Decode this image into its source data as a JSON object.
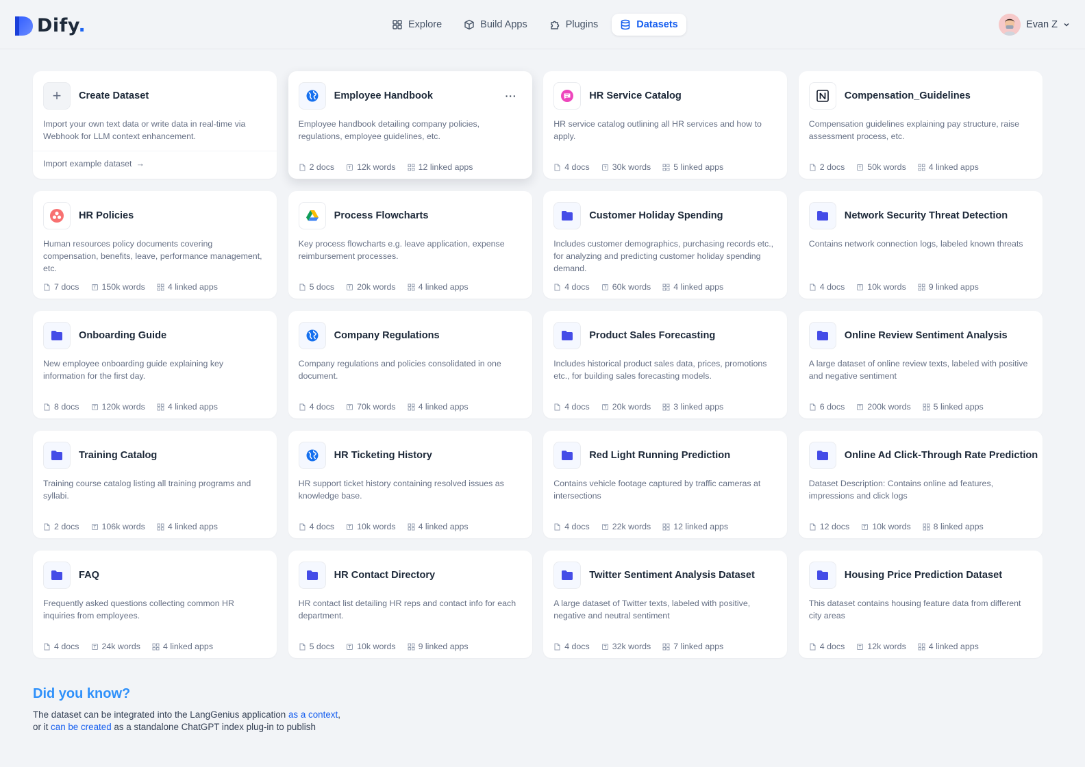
{
  "app": {
    "name": "Dify",
    "name_suffix": "."
  },
  "nav": {
    "items": [
      {
        "label": "Explore",
        "icon": "grid-icon"
      },
      {
        "label": "Build Apps",
        "icon": "cube-icon"
      },
      {
        "label": "Plugins",
        "icon": "puzzle-icon"
      },
      {
        "label": "Datasets",
        "icon": "database-icon",
        "active": true
      }
    ]
  },
  "user": {
    "name": "Evan Z"
  },
  "create": {
    "title": "Create Dataset",
    "description": "Import your own text data or write data in real-time via Webhook for LLM context enhancement.",
    "link": "Import example dataset",
    "arrow": "→"
  },
  "datasets": [
    {
      "title": "Employee Handbook",
      "icon": "globe-icon",
      "description": "Employee handbook detailing company policies, regulations, employee guidelines, etc.",
      "docs": "2 docs",
      "words": "12k words",
      "apps": "12 linked apps"
    },
    {
      "title": "HR Service Catalog",
      "icon": "chat-bubble-icon",
      "description": "HR service catalog outlining all HR services and how to apply.",
      "docs": "4 docs",
      "words": "30k words",
      "apps": "5 linked apps"
    },
    {
      "title": "Compensation_Guidelines",
      "icon": "notion-icon",
      "description": "Compensation guidelines explaining pay structure, raise assessment process, etc.",
      "docs": "2 docs",
      "words": "50k words",
      "apps": "4 linked apps"
    },
    {
      "title": "HR Policies",
      "icon": "asana-icon",
      "description": "Human resources policy documents covering compensation, benefits, leave, performance management, etc.",
      "docs": "7 docs",
      "words": "150k words",
      "apps": "4 linked apps"
    },
    {
      "title": "Process Flowcharts",
      "icon": "google-drive-icon",
      "description": "Key process flowcharts e.g. leave application, expense reimbursement processes.",
      "docs": "5 docs",
      "words": "20k words",
      "apps": "4 linked apps"
    },
    {
      "title": "Customer Holiday Spending",
      "icon": "folder-icon",
      "description": "Includes customer demographics, purchasing records etc., for analyzing and predicting customer holiday spending demand.",
      "docs": "4 docs",
      "words": "60k words",
      "apps": "4 linked apps"
    },
    {
      "title": "Network Security Threat Detection",
      "icon": "folder-icon",
      "description": "Contains network connection logs, labeled known threats",
      "docs": "4 docs",
      "words": "10k words",
      "apps": "9 linked apps"
    },
    {
      "title": "Onboarding Guide",
      "icon": "folder-icon",
      "description": "New employee onboarding guide explaining key information for the first day.",
      "docs": "8 docs",
      "words": "120k words",
      "apps": "4 linked apps"
    },
    {
      "title": "Company Regulations",
      "icon": "globe-icon",
      "description": "Company regulations and policies consolidated in one document.",
      "docs": "4 docs",
      "words": "70k words",
      "apps": "4 linked apps"
    },
    {
      "title": "Product Sales Forecasting",
      "icon": "folder-icon",
      "description": " Includes historical product sales data, prices, promotions etc., for building sales forecasting models.",
      "docs": "4 docs",
      "words": "20k words",
      "apps": "3 linked apps"
    },
    {
      "title": "Online Review Sentiment Analysis",
      "icon": "folder-icon",
      "description": "A large dataset of online review texts, labeled with positive and negative sentiment",
      "docs": "6 docs",
      "words": "200k words",
      "apps": "5 linked apps"
    },
    {
      "title": "Training Catalog",
      "icon": "folder-icon",
      "description": "Training course catalog listing all training programs and syllabi.",
      "docs": "2 docs",
      "words": "106k words",
      "apps": "4 linked apps"
    },
    {
      "title": "HR Ticketing History",
      "icon": "globe-icon",
      "description": "HR support ticket history containing resolved issues as knowledge base.",
      "docs": "4 docs",
      "words": "10k words",
      "apps": "4 linked apps"
    },
    {
      "title": "Red Light Running Prediction",
      "icon": "folder-icon",
      "description": "Contains vehicle footage captured by traffic cameras at intersections",
      "docs": "4 docs",
      "words": "22k words",
      "apps": "12 linked apps"
    },
    {
      "title": "Online Ad Click-Through Rate Prediction",
      "icon": "folder-icon",
      "description": "Dataset Description: Contains online ad features, impressions and click logs",
      "docs": "12 docs",
      "words": "10k words",
      "apps": "8 linked apps"
    },
    {
      "title": "FAQ",
      "icon": "folder-icon",
      "description": "Frequently asked questions collecting common HR inquiries from employees.",
      "docs": "4 docs",
      "words": "24k words",
      "apps": "4 linked apps"
    },
    {
      "title": "HR Contact Directory",
      "icon": "folder-icon",
      "description": "HR contact list detailing HR reps and contact info for each department.",
      "docs": "5 docs",
      "words": "10k words",
      "apps": "9 linked apps"
    },
    {
      "title": "Twitter Sentiment Analysis Dataset",
      "icon": "folder-icon",
      "description": "A large dataset of Twitter texts, labeled with positive, negative and neutral sentiment",
      "docs": "4 docs",
      "words": "32k words",
      "apps": "7 linked apps"
    },
    {
      "title": "Housing Price Prediction Dataset",
      "icon": "folder-icon",
      "description": "This dataset contains housing feature data from different city areas",
      "docs": "4 docs",
      "words": "12k words",
      "apps": "4 linked apps"
    }
  ],
  "more_label": "···",
  "did_you_know": {
    "title": "Did you know?",
    "line1_a": "The dataset can be integrated into the LangGenius application ",
    "line1_link": "as a context",
    "line1_b": ",",
    "line2_a": "or it ",
    "line2_link": "can be created",
    "line2_b": " as a standalone ChatGPT index plug-in to publish"
  },
  "colors": {
    "accent": "#155EEF",
    "folder": "#444CE7",
    "globe": "#1570EF",
    "chat": "#EE46BC",
    "dyk_title": "#2E90FA"
  }
}
